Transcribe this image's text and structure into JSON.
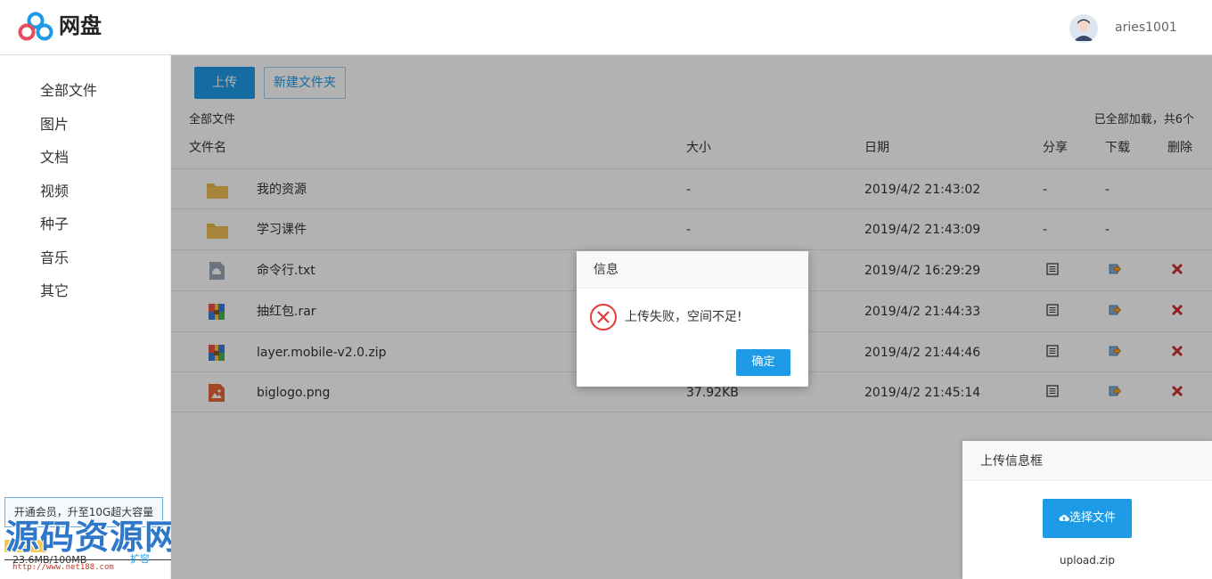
{
  "app": {
    "title": "网盘",
    "username": "aries1001"
  },
  "sidebar": {
    "items": [
      {
        "label": "全部文件"
      },
      {
        "label": "图片"
      },
      {
        "label": "文档"
      },
      {
        "label": "视频"
      },
      {
        "label": "种子"
      },
      {
        "label": "音乐"
      },
      {
        "label": "其它"
      }
    ],
    "member_promo": "开通会员，升至10G超大容量",
    "quota_text": "23.6MB/100MB",
    "quota_used_fraction": 0.236,
    "expand_label": "扩容"
  },
  "watermark": {
    "text": "源码资源网",
    "url": "http://www.net188.com"
  },
  "toolbar": {
    "upload_label": "上传",
    "new_folder_label": "新建文件夹"
  },
  "breadcrumb": "全部文件",
  "loaded_status": "已全部加载，共6个",
  "table": {
    "headers": {
      "name": "文件名",
      "size": "大小",
      "date": "日期",
      "share": "分享",
      "download": "下载",
      "delete": "删除"
    },
    "rows": [
      {
        "type": "folder",
        "name": "我的资源",
        "size": "-",
        "date": "2019/4/2 21:43:02",
        "share": "-",
        "download": "-"
      },
      {
        "type": "folder",
        "name": "学习课件",
        "size": "-",
        "date": "2019/4/2 21:43:09",
        "share": "-",
        "download": "-"
      },
      {
        "type": "text",
        "name": "命令行.txt",
        "size": "",
        "date": "2019/4/2 16:29:29"
      },
      {
        "type": "archive",
        "name": "抽红包.rar",
        "size": "",
        "date": "2019/4/2 21:44:33"
      },
      {
        "type": "archive",
        "name": "layer.mobile-v2.0.zip",
        "size": "",
        "date": "2019/4/2 21:44:46"
      },
      {
        "type": "image",
        "name": "biglogo.png",
        "size": "37.92KB",
        "date": "2019/4/2 21:45:14"
      }
    ]
  },
  "dialog": {
    "title": "信息",
    "message": "上传失败，空间不足!",
    "confirm_label": "确定"
  },
  "upload_panel": {
    "title": "上传信息框",
    "select_label": "选择文件",
    "file_name": "upload.zip"
  },
  "colors": {
    "accent": "#1e9be6",
    "error": "#e53935",
    "folder": "#f0c056",
    "delete": "#d32f2f"
  }
}
